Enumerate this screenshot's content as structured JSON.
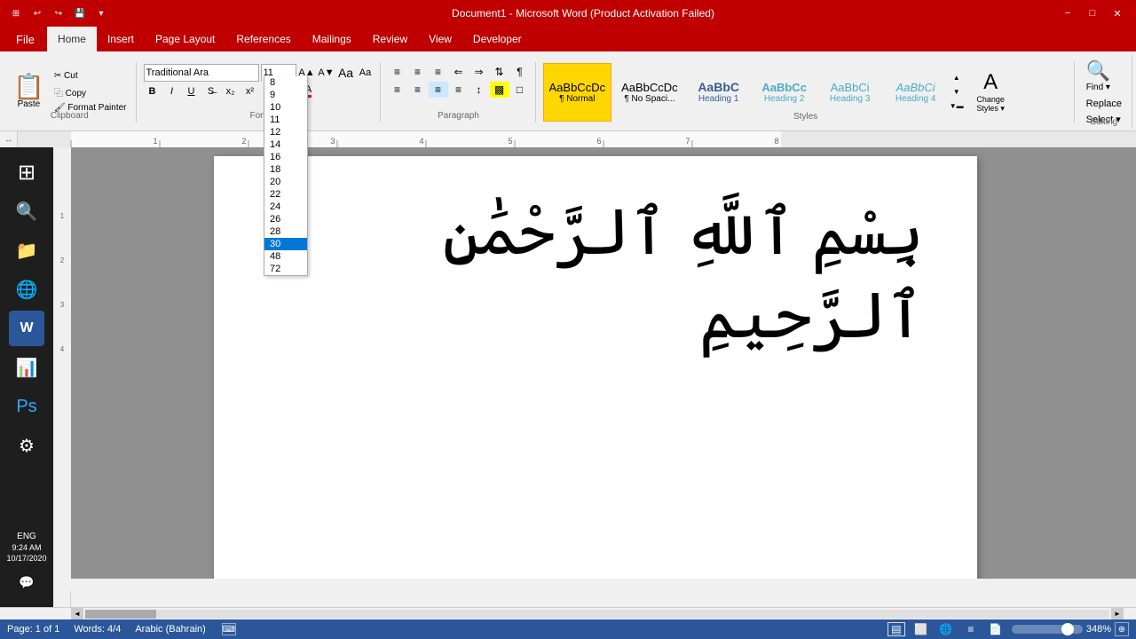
{
  "titleBar": {
    "title": "Document1 - Microsoft Word (Product Activation Failed)",
    "minimize": "−",
    "maximize": "□",
    "close": "✕",
    "quickAccess": [
      "↩",
      "↪",
      "💾",
      "✏"
    ]
  },
  "menuBar": {
    "file": "File",
    "tabs": [
      "Home",
      "Insert",
      "Page Layout",
      "References",
      "Mailings",
      "Review",
      "View",
      "Developer"
    ],
    "activeTab": "Home"
  },
  "ribbon": {
    "clipboard": {
      "label": "Clipboard",
      "paste": "Paste",
      "cut": "Cut",
      "copy": "Copy",
      "formatPainter": "Format Painter"
    },
    "font": {
      "label": "Font",
      "fontName": "Traditional Ara",
      "fontSize": "11",
      "fontSizeDropdown": [
        "8",
        "9",
        "10",
        "11",
        "12",
        "14",
        "16",
        "18",
        "20",
        "22",
        "24",
        "26",
        "28",
        "30",
        "48",
        "72"
      ],
      "bold": "B",
      "italic": "I",
      "underline": "U",
      "strikethrough": "S"
    },
    "paragraph": {
      "label": "Paragraph",
      "bullets": "≡",
      "numbering": "≡",
      "align": [
        "≡",
        "≡",
        "≡",
        "≡"
      ]
    },
    "styles": {
      "label": "Styles",
      "items": [
        {
          "name": "Normal",
          "label": "¶ Normal",
          "active": true
        },
        {
          "name": "No Spacing",
          "label": "¶ No Spaci..."
        },
        {
          "name": "Heading 1",
          "label": "Heading 1"
        },
        {
          "name": "Heading 2",
          "label": "Heading 2"
        },
        {
          "name": "Heading 3",
          "label": "Heading 3"
        },
        {
          "name": "Heading 4",
          "label": "Heading 4"
        }
      ],
      "changeStyles": "Change\nStyles ="
    },
    "editing": {
      "label": "Editing",
      "find": "Find ▾",
      "replace": "Replace",
      "select": "Select ▾"
    }
  },
  "fontSizeDropdownValues": {
    "sizes": [
      "8",
      "9",
      "10",
      "11",
      "12",
      "14",
      "16",
      "18",
      "20",
      "22",
      "24",
      "26",
      "28",
      "30",
      "48",
      "72"
    ],
    "highlighted": "30"
  },
  "document": {
    "content": "بِسْمِ ٱللَّهِ ٱلرَّحْمَٰنِ ٱلرَّحِيمِ",
    "page": "Page: 1 of 1",
    "words": "Words: 4/4",
    "language": "Arabic (Bahrain)",
    "zoom": "348%"
  },
  "statusBar": {
    "page": "Page: 1 of 1",
    "words": "Words: 4/4",
    "language": "Arabic (Bahrain)",
    "zoom": "348%",
    "zoomSlider": 348
  },
  "taskbar": {
    "items": [
      "⊞",
      "🔍",
      "📁",
      "🌐",
      "W",
      "📊",
      "🎨",
      "⚙"
    ]
  },
  "datetime": {
    "time": "9:24 AM",
    "date": "10/17/2020",
    "lang": "ENG"
  }
}
